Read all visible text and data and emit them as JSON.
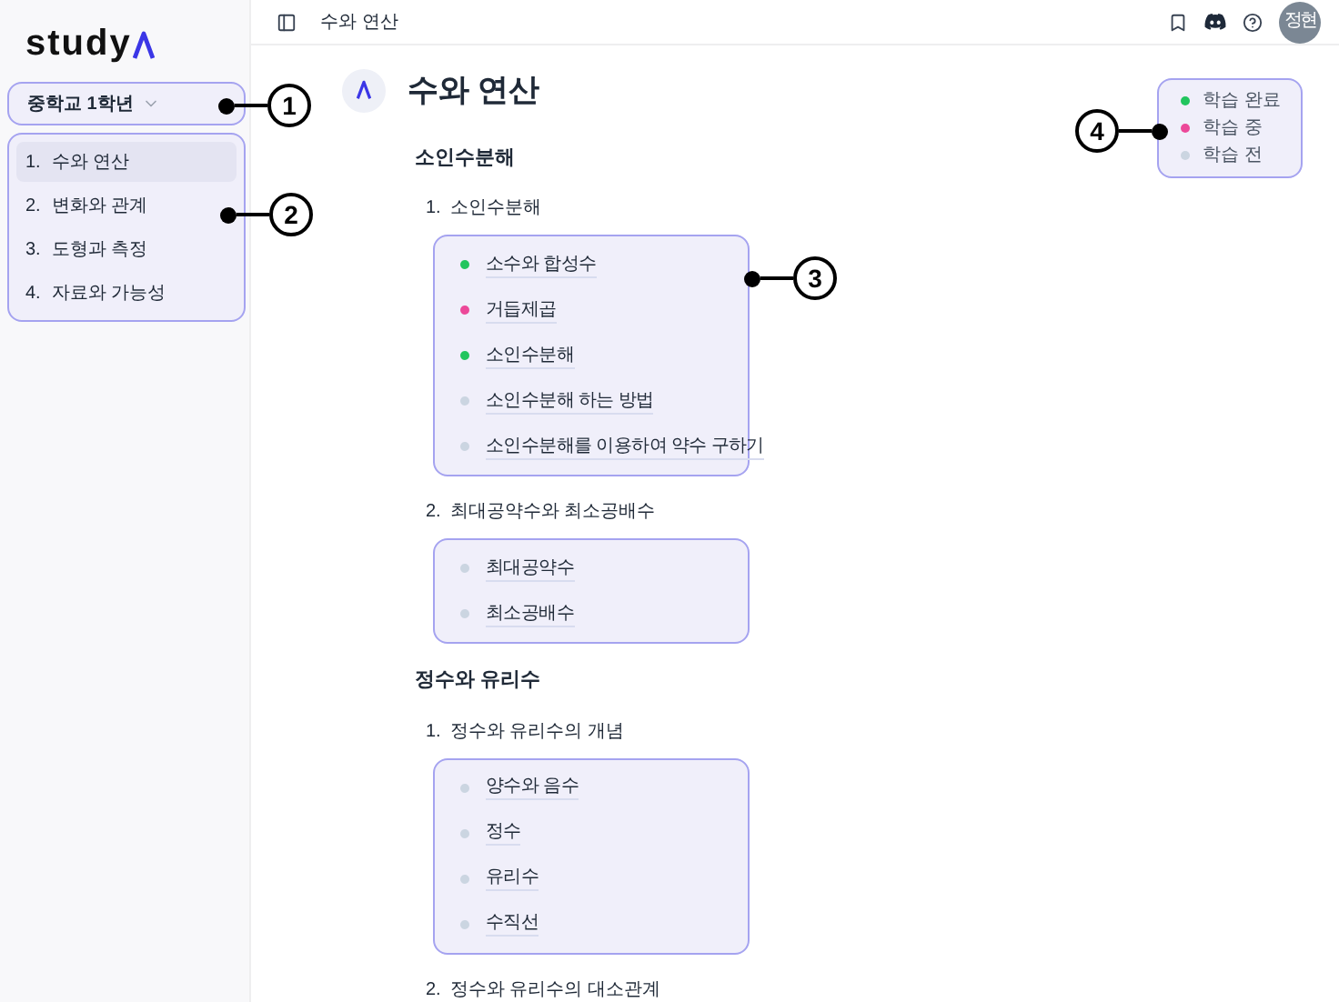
{
  "logo": {
    "text": "study"
  },
  "grade_select": {
    "label": "중학교 1학년"
  },
  "chapters": [
    {
      "number": "1.",
      "label": "수와 연산",
      "selected": true
    },
    {
      "number": "2.",
      "label": "변화와 관계",
      "selected": false
    },
    {
      "number": "3.",
      "label": "도형과 측정",
      "selected": false
    },
    {
      "number": "4.",
      "label": "자료와 가능성",
      "selected": false
    }
  ],
  "header": {
    "title": "수와 연산",
    "avatar": "정현"
  },
  "page": {
    "title": "수와 연산"
  },
  "legend": [
    {
      "label": "학습 완료",
      "color": "#22c55e"
    },
    {
      "label": "학습 중",
      "color": "#ec4899"
    },
    {
      "label": "학습 전",
      "color": "#cbd5e1"
    }
  ],
  "sections": [
    {
      "title": "소인수분해",
      "units": [
        {
          "number": "1.",
          "title": "소인수분해",
          "topics": [
            {
              "label": "소수와 합성수",
              "color": "#22c55e"
            },
            {
              "label": "거듭제곱",
              "color": "#ec4899"
            },
            {
              "label": "소인수분해",
              "color": "#22c55e"
            },
            {
              "label": "소인수분해 하는 방법",
              "color": "#cbd5e1"
            },
            {
              "label": "소인수분해를 이용하여 약수 구하기",
              "color": "#cbd5e1"
            }
          ]
        },
        {
          "number": "2.",
          "title": "최대공약수와 최소공배수",
          "topics": [
            {
              "label": "최대공약수",
              "color": "#cbd5e1"
            },
            {
              "label": "최소공배수",
              "color": "#cbd5e1"
            }
          ]
        }
      ]
    },
    {
      "title": "정수와 유리수",
      "units": [
        {
          "number": "1.",
          "title": "정수와 유리수의 개념",
          "topics": [
            {
              "label": "양수와 음수",
              "color": "#cbd5e1"
            },
            {
              "label": "정수",
              "color": "#cbd5e1"
            },
            {
              "label": "유리수",
              "color": "#cbd5e1"
            },
            {
              "label": "수직선",
              "color": "#cbd5e1"
            }
          ]
        },
        {
          "number": "2.",
          "title": "정수와 유리수의 대소관계"
        }
      ]
    }
  ],
  "callouts": [
    "1",
    "2",
    "3",
    "4"
  ]
}
